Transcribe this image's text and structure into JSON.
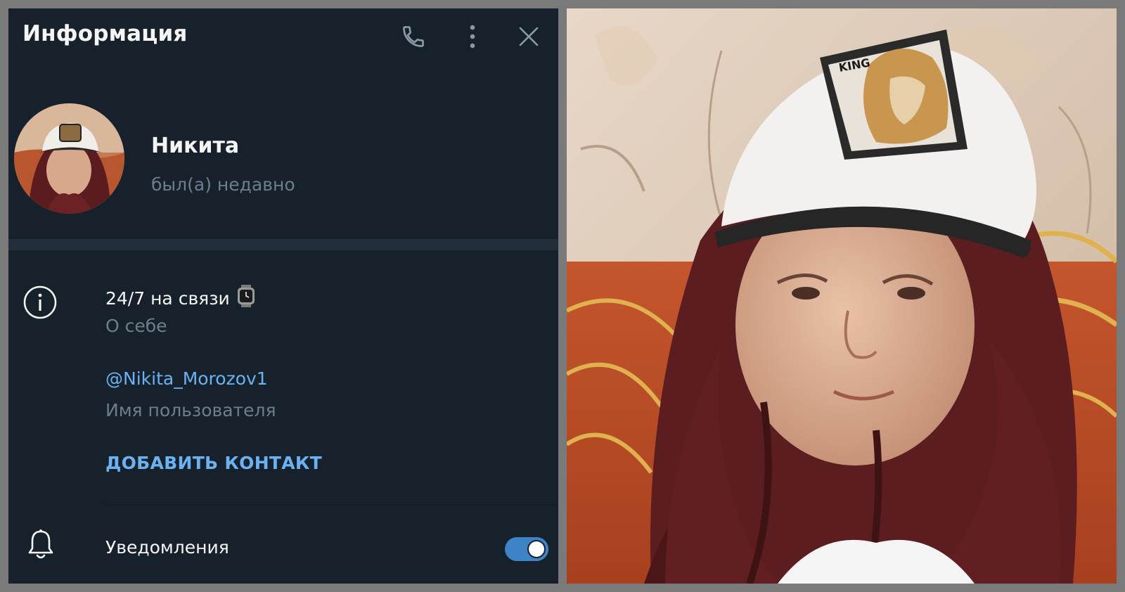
{
  "header": {
    "title": "Информация",
    "icons": [
      "phone-icon",
      "more-vertical-icon",
      "close-icon"
    ]
  },
  "profile": {
    "name": "Никита",
    "status": "был(а) недавно"
  },
  "info": {
    "bio": "24/7 на связи",
    "bio_emoji": "watch-icon",
    "bio_label": "О себе",
    "username": "@Nikita_Morozov1",
    "username_label": "Имя пользователя",
    "add_contact_label": "ДОБАВИТЬ КОНТАКТ"
  },
  "notifications": {
    "label": "Уведомления",
    "enabled": true
  },
  "colors": {
    "panel_bg": "#17212b",
    "accent": "#6ab2f2",
    "toggle": "#3d83c5",
    "muted_text": "#6d7f8f"
  },
  "photo": {
    "cap_patch_text": "KING"
  }
}
